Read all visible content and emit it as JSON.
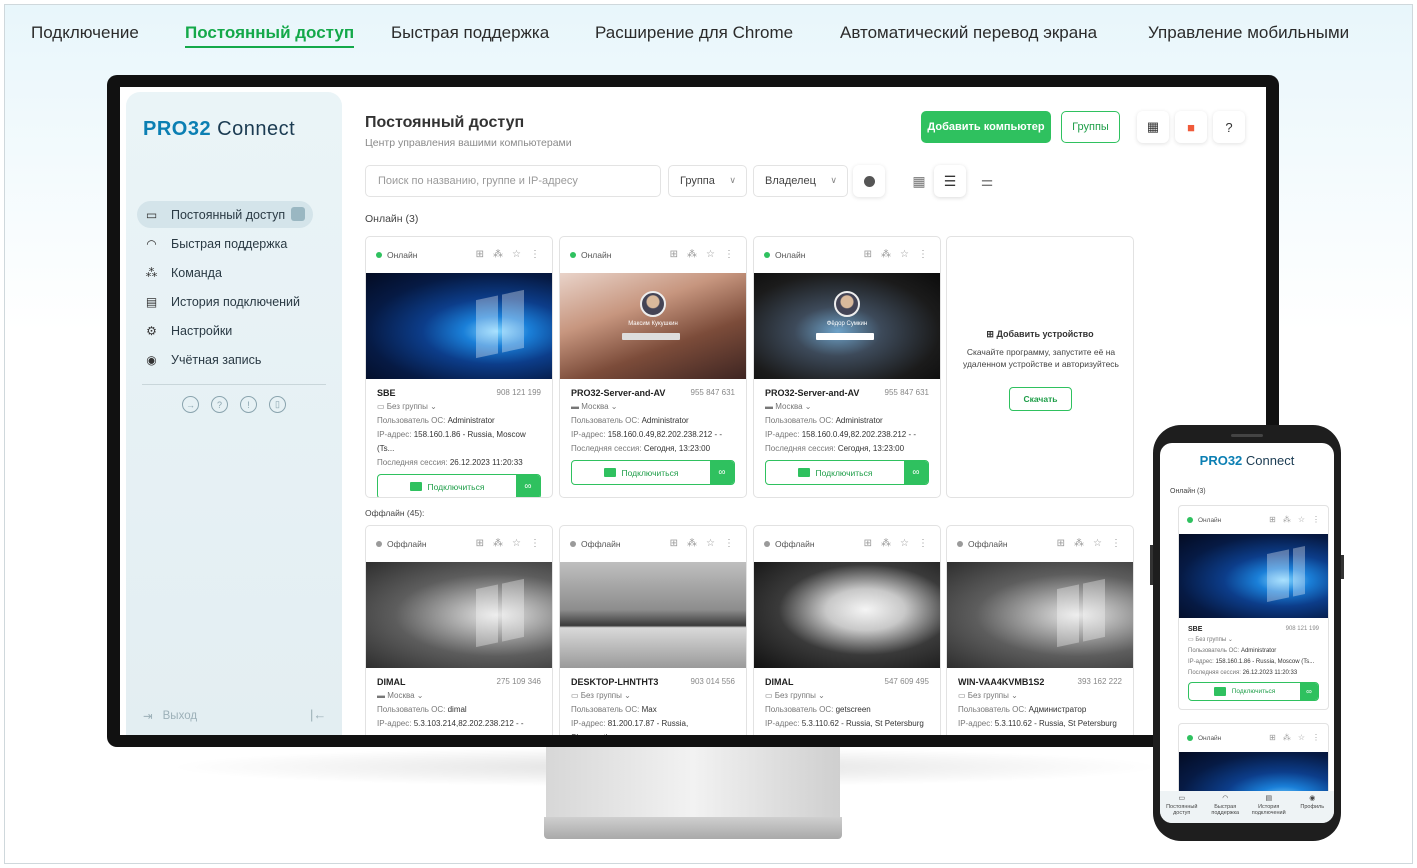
{
  "topnav": [
    "Подключение",
    "Постоянный доступ",
    "Быстрая поддержка",
    "Расширение для Chrome",
    "Автоматический перевод экрана",
    "Управление мобильными"
  ],
  "colors": {
    "accent": "#2fc15f",
    "brand": "#0b7fb3",
    "online": "#2fc15f",
    "offline": "#9a9a9a"
  },
  "logo": {
    "pro": "PRO32",
    "connect": "Connect"
  },
  "sidebar": {
    "items": [
      {
        "label": "Постоянный доступ",
        "icon": "monitor-icon"
      },
      {
        "label": "Быстрая поддержка",
        "icon": "headset-icon"
      },
      {
        "label": "Команда",
        "icon": "team-icon"
      },
      {
        "label": "История подключений",
        "icon": "history-icon"
      },
      {
        "label": "Настройки",
        "icon": "gear-icon"
      },
      {
        "label": "Учётная запись",
        "icon": "account-icon"
      }
    ],
    "logout": "Выход"
  },
  "header": {
    "title": "Постоянный доступ",
    "subtitle": "Центр управления вашими компьютерами",
    "add_button": "Добавить компьютер",
    "groups_button": "Группы"
  },
  "filters": {
    "search_placeholder": "Поиск по названию, группе и IP-адресу",
    "group": "Группа",
    "owner": "Владелец"
  },
  "online_label": "Онлайн (3)",
  "offline_label": "Оффлайн (45):",
  "labels": {
    "user": "Пользователь ОС:",
    "ip": "IP-адрес:",
    "last": "Последняя сессия:",
    "connect": "Подключиться"
  },
  "online_cards": [
    {
      "status": "Онлайн",
      "name": "SBE",
      "num": "908 121 199",
      "group": "Без группы",
      "user": "Administrator",
      "ip": "158.160.1.86 - Russia, Moscow (Ts...",
      "last": "26.12.2023 11:20:33",
      "thumb": "win-blue"
    },
    {
      "status": "Онлайн",
      "name": "PRO32-Server-and-AV",
      "num": "955 847 631",
      "group": "Москва",
      "user": "Administrator",
      "ip": "158.160.0.49,82.202.238.212 - -",
      "last": "Сегодня, 13:23:00",
      "thumb": "warm-blur",
      "login": "Максим Кукушкин"
    },
    {
      "status": "Онлайн",
      "name": "PRO32-Server-and-AV",
      "num": "955 847 631",
      "group": "Москва",
      "user": "Administrator",
      "ip": "158.160.0.49,82.202.238.212 - -",
      "last": "Сегодня, 13:23:00",
      "thumb": "dark-blur",
      "login": "Фёдор Сумкин"
    }
  ],
  "add_device": {
    "title": "Добавить устройство",
    "desc": "Скачайте программу, запустите её на удаленном устройстве и авторизуйтесь",
    "button": "Скачать"
  },
  "offline_cards": [
    {
      "status": "Оффлайн",
      "name": "DIMAL",
      "num": "275 109 346",
      "group": "Москва",
      "user": "dimal",
      "ip": "5.3.103.214,82.202.238.212 - -",
      "thumb": "win-gray"
    },
    {
      "status": "Оффлайн",
      "name": "DESKTOP-LHNTHT3",
      "num": "903 014 556",
      "group": "Без группы",
      "user": "Max",
      "ip": "81.200.17.87 - Russia, Sheremet'y...",
      "thumb": "rock-bw"
    },
    {
      "status": "Оффлайн",
      "name": "DIMAL",
      "num": "547 609 495",
      "group": "Без группы",
      "user": "getscreen",
      "ip": "5.3.110.62 - Russia, St Petersburg",
      "thumb": "cave-bw"
    },
    {
      "status": "Оффлайн",
      "name": "WIN-VAA4KVMB1S2",
      "num": "393 162 222",
      "group": "Без группы",
      "user": "Администратор",
      "ip": "5.3.110.62 - Russia, St Petersburg",
      "thumb": "win-gray"
    }
  ],
  "phone": {
    "online_label": "Онлайн (3)",
    "card": {
      "status": "Онлайн",
      "name": "SBE",
      "num": "908 121 199",
      "group": "Без группы",
      "user": "Administrator",
      "ip": "158.160.1.86 - Russia, Moscow (Ts...",
      "last": "26.12.2023 11:20:33"
    },
    "card2_status": "Онлайн",
    "tabs": [
      "Постоянный доступ",
      "Быстрая поддержка",
      "История подключений",
      "Профиль"
    ]
  }
}
